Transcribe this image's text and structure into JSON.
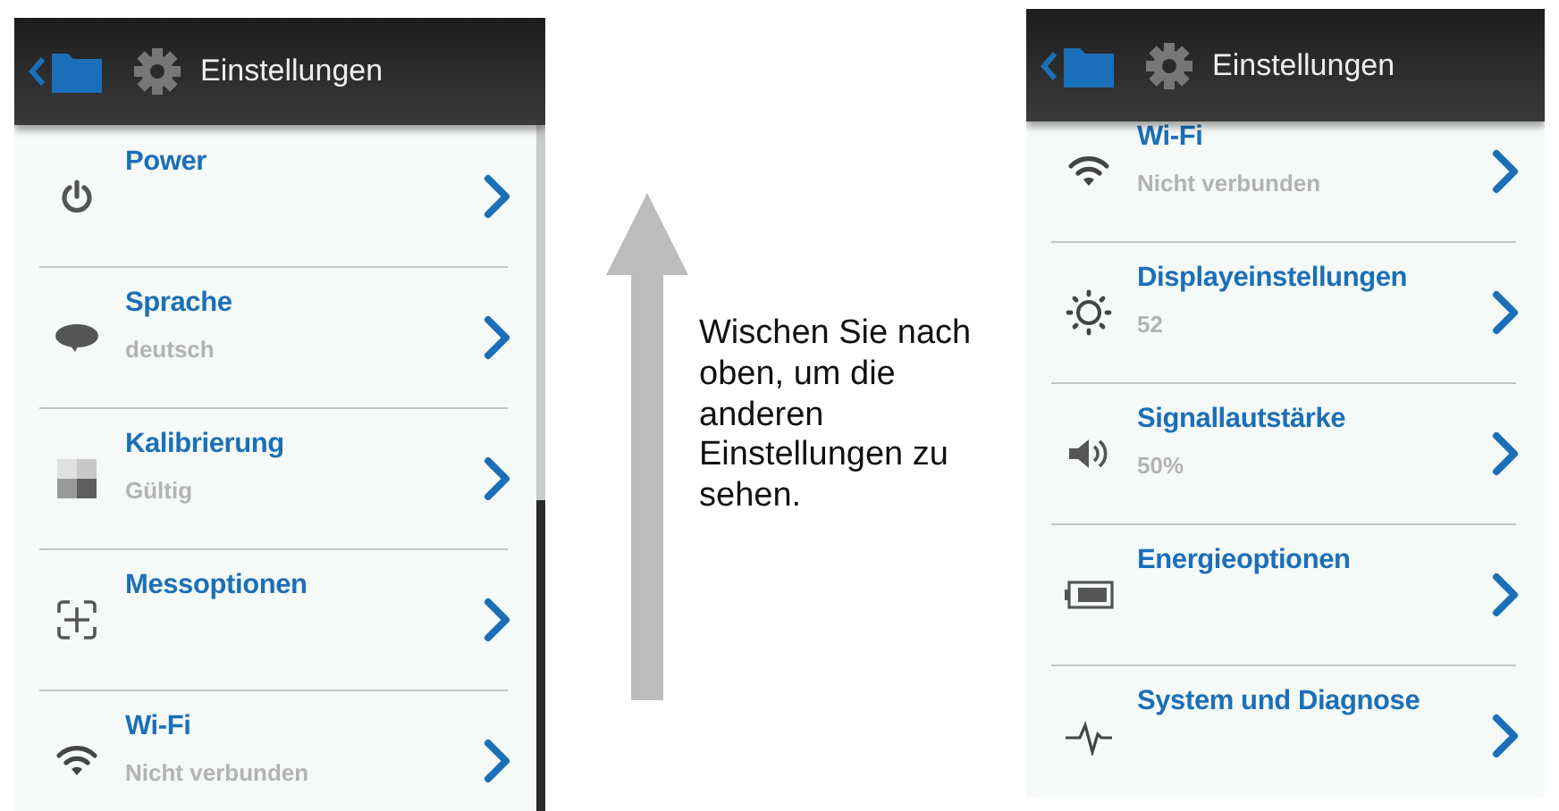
{
  "screens": [
    {
      "title": "Einstellungen",
      "items": [
        {
          "kind": "power",
          "label": "Power"
        },
        {
          "kind": "language",
          "label": "Sprache",
          "detail": "deutsch"
        },
        {
          "kind": "calibration",
          "label": "Kalibrierung",
          "detail": "Gültig"
        },
        {
          "kind": "measure",
          "label": "Messoptionen"
        },
        {
          "kind": "wifi",
          "label": "Wi-Fi",
          "detail": "Nicht verbunden"
        }
      ]
    },
    {
      "title": "Einstellungen",
      "items": [
        {
          "kind": "wifi",
          "label": "Wi-Fi",
          "detail": "Nicht verbunden"
        },
        {
          "kind": "display",
          "label": "Displayeinstellungen",
          "detail": "52"
        },
        {
          "kind": "volume",
          "label": "Signallautstärke",
          "detail": "50%"
        },
        {
          "kind": "battery",
          "label": "Energieoptionen"
        },
        {
          "kind": "system",
          "label": "System und Diagnose"
        }
      ]
    }
  ],
  "instruction": "Wischen Sie nach oben, um die anderen Einstellungen zu sehen."
}
